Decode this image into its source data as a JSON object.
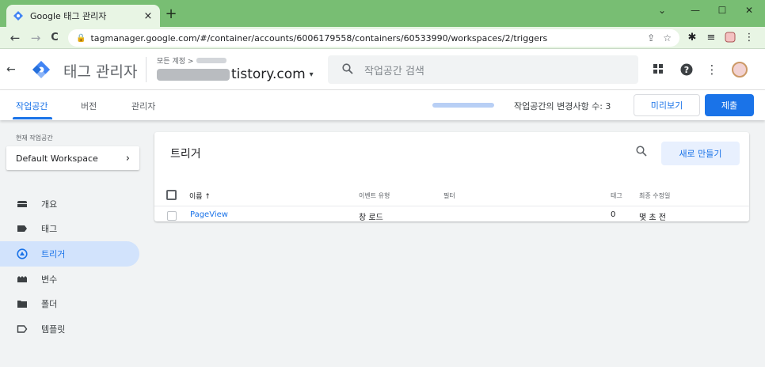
{
  "browser": {
    "tab_title": "Google 태그 관리자",
    "tab_close": "×",
    "new_tab": "+",
    "window_controls": [
      "⌄",
      "—",
      "☐",
      "✕"
    ],
    "url": "tagmanager.google.com/#/container/accounts/6006179558/containers/60533990/workspaces/2/triggers",
    "back": "←",
    "forward": "→",
    "reload": "C",
    "omnibox_icons": [
      "share-icon",
      "star-icon"
    ],
    "extension_icons": [
      "puzzle-icon",
      "reading-list-icon",
      "profile-icon",
      "menu-icon"
    ]
  },
  "header": {
    "back": "←",
    "product_name": "태그 관리자",
    "account_line": "모든 계정 >",
    "container_name": "tistory.com",
    "container_caret": "▾",
    "search_placeholder": "작업공간 검색",
    "icons": [
      "apps-icon",
      "help-icon",
      "more-icon"
    ]
  },
  "subnav": {
    "tabs": [
      {
        "label": "작업공간",
        "active": true
      },
      {
        "label": "버전",
        "active": false
      },
      {
        "label": "관리자",
        "active": false
      }
    ],
    "changes_text": "작업공간의 변경사항 수: 3",
    "preview_button": "미리보기",
    "submit_button": "제출"
  },
  "sidebar": {
    "workspace_label": "현재 작업공간",
    "workspace_name": "Default Workspace",
    "workspace_chevron": "›",
    "items": [
      {
        "label": "개요",
        "icon": "overview-icon",
        "active": false
      },
      {
        "label": "태그",
        "icon": "tag-icon",
        "active": false
      },
      {
        "label": "트리거",
        "icon": "trigger-icon",
        "active": true
      },
      {
        "label": "변수",
        "icon": "variables-icon",
        "active": false
      },
      {
        "label": "폴더",
        "icon": "folder-icon",
        "active": false
      },
      {
        "label": "템플릿",
        "icon": "template-icon",
        "active": false
      }
    ]
  },
  "card": {
    "title": "트리거",
    "new_button": "새로 만들기",
    "columns": [
      "이름 ↑",
      "이벤트 유형",
      "필터",
      "태그",
      "최종 수정일"
    ],
    "rows": [
      {
        "name": "PageView",
        "event_type": "창 로드",
        "filter": "",
        "tags": "0",
        "last_modified": "몇 초 전"
      }
    ]
  },
  "colors": {
    "accent": "#1a73e8",
    "tabbar": "#78be73",
    "active_nav": "#d2e3fc"
  }
}
